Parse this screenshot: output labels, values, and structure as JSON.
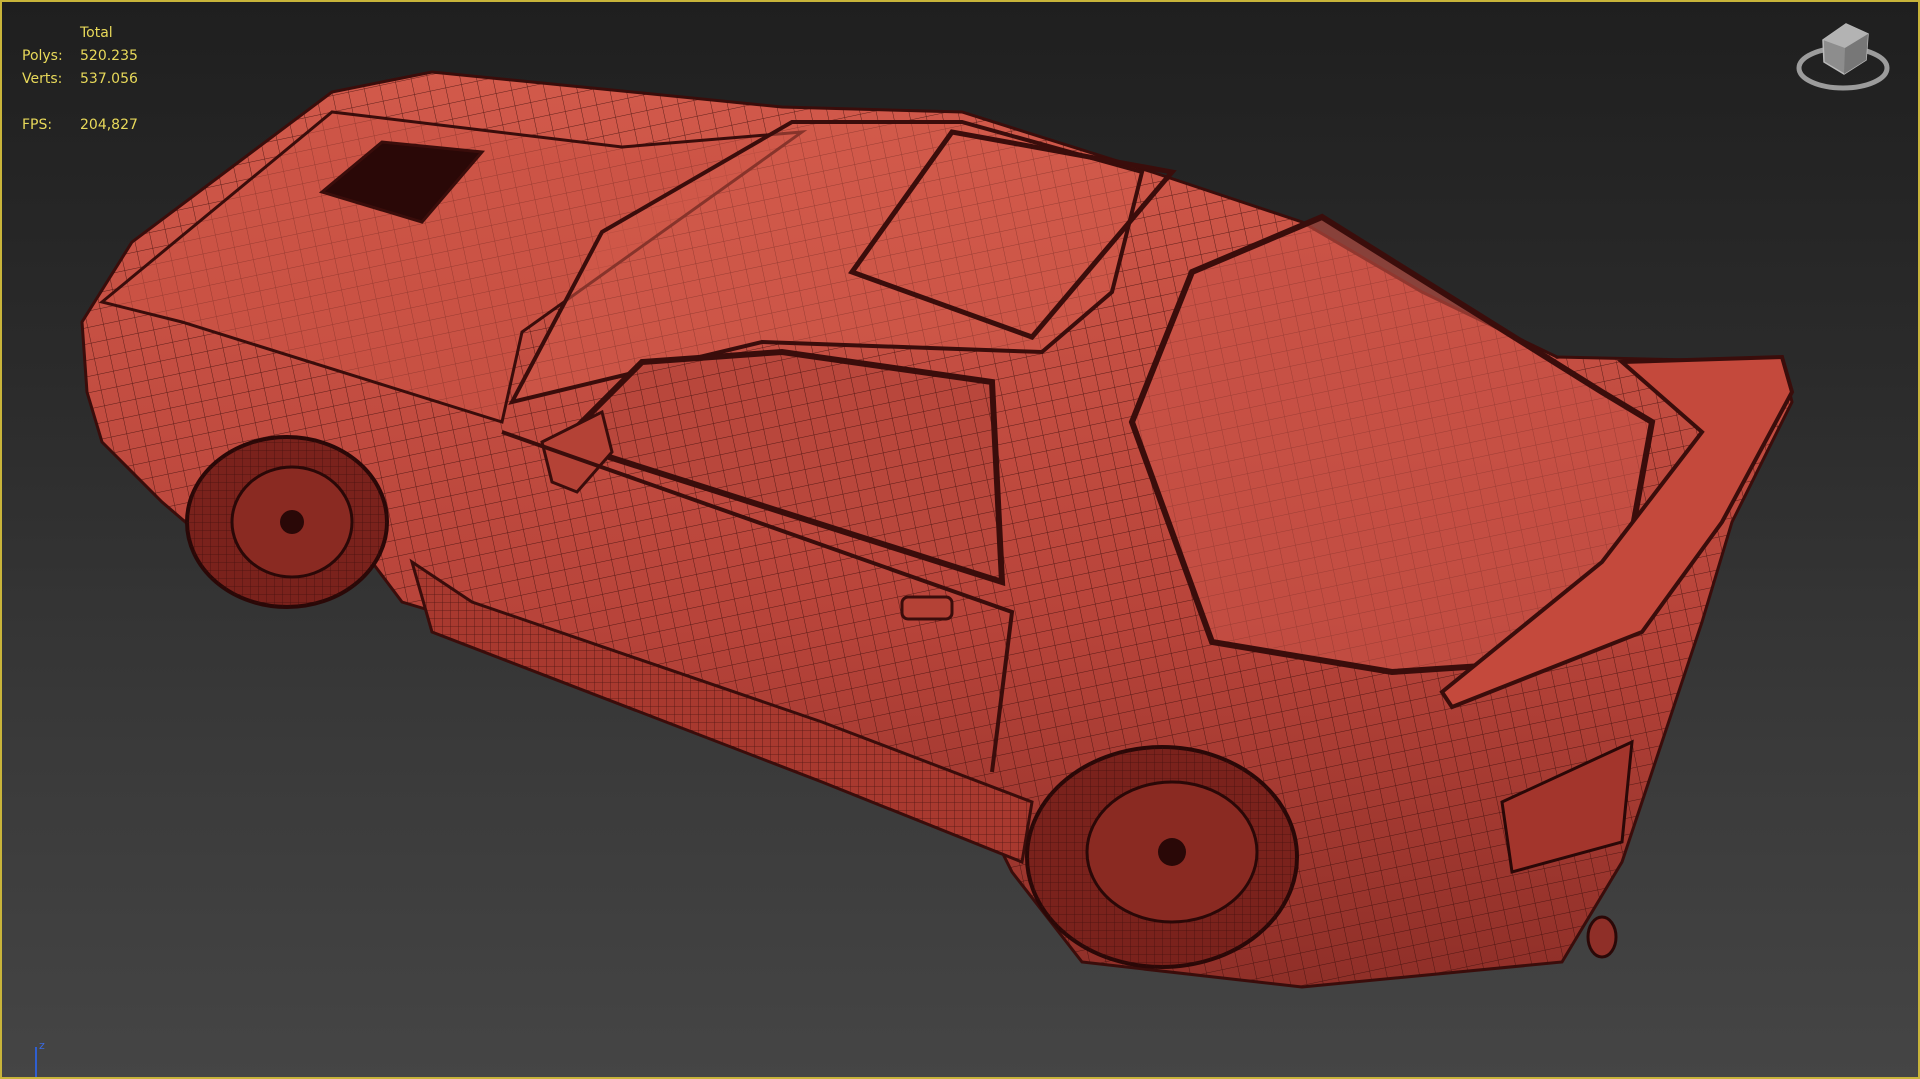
{
  "stats": {
    "header": "Total",
    "polys_label": "Polys:",
    "polys_value": "520.235",
    "verts_label": "Verts:",
    "verts_value": "537.056",
    "fps_label": "FPS:",
    "fps_value": "204,827"
  },
  "viewport": {
    "border_color": "#c8b43a",
    "model_color": "#c0493c",
    "wire_color": "#3a0d0b",
    "axis_label": "z"
  }
}
